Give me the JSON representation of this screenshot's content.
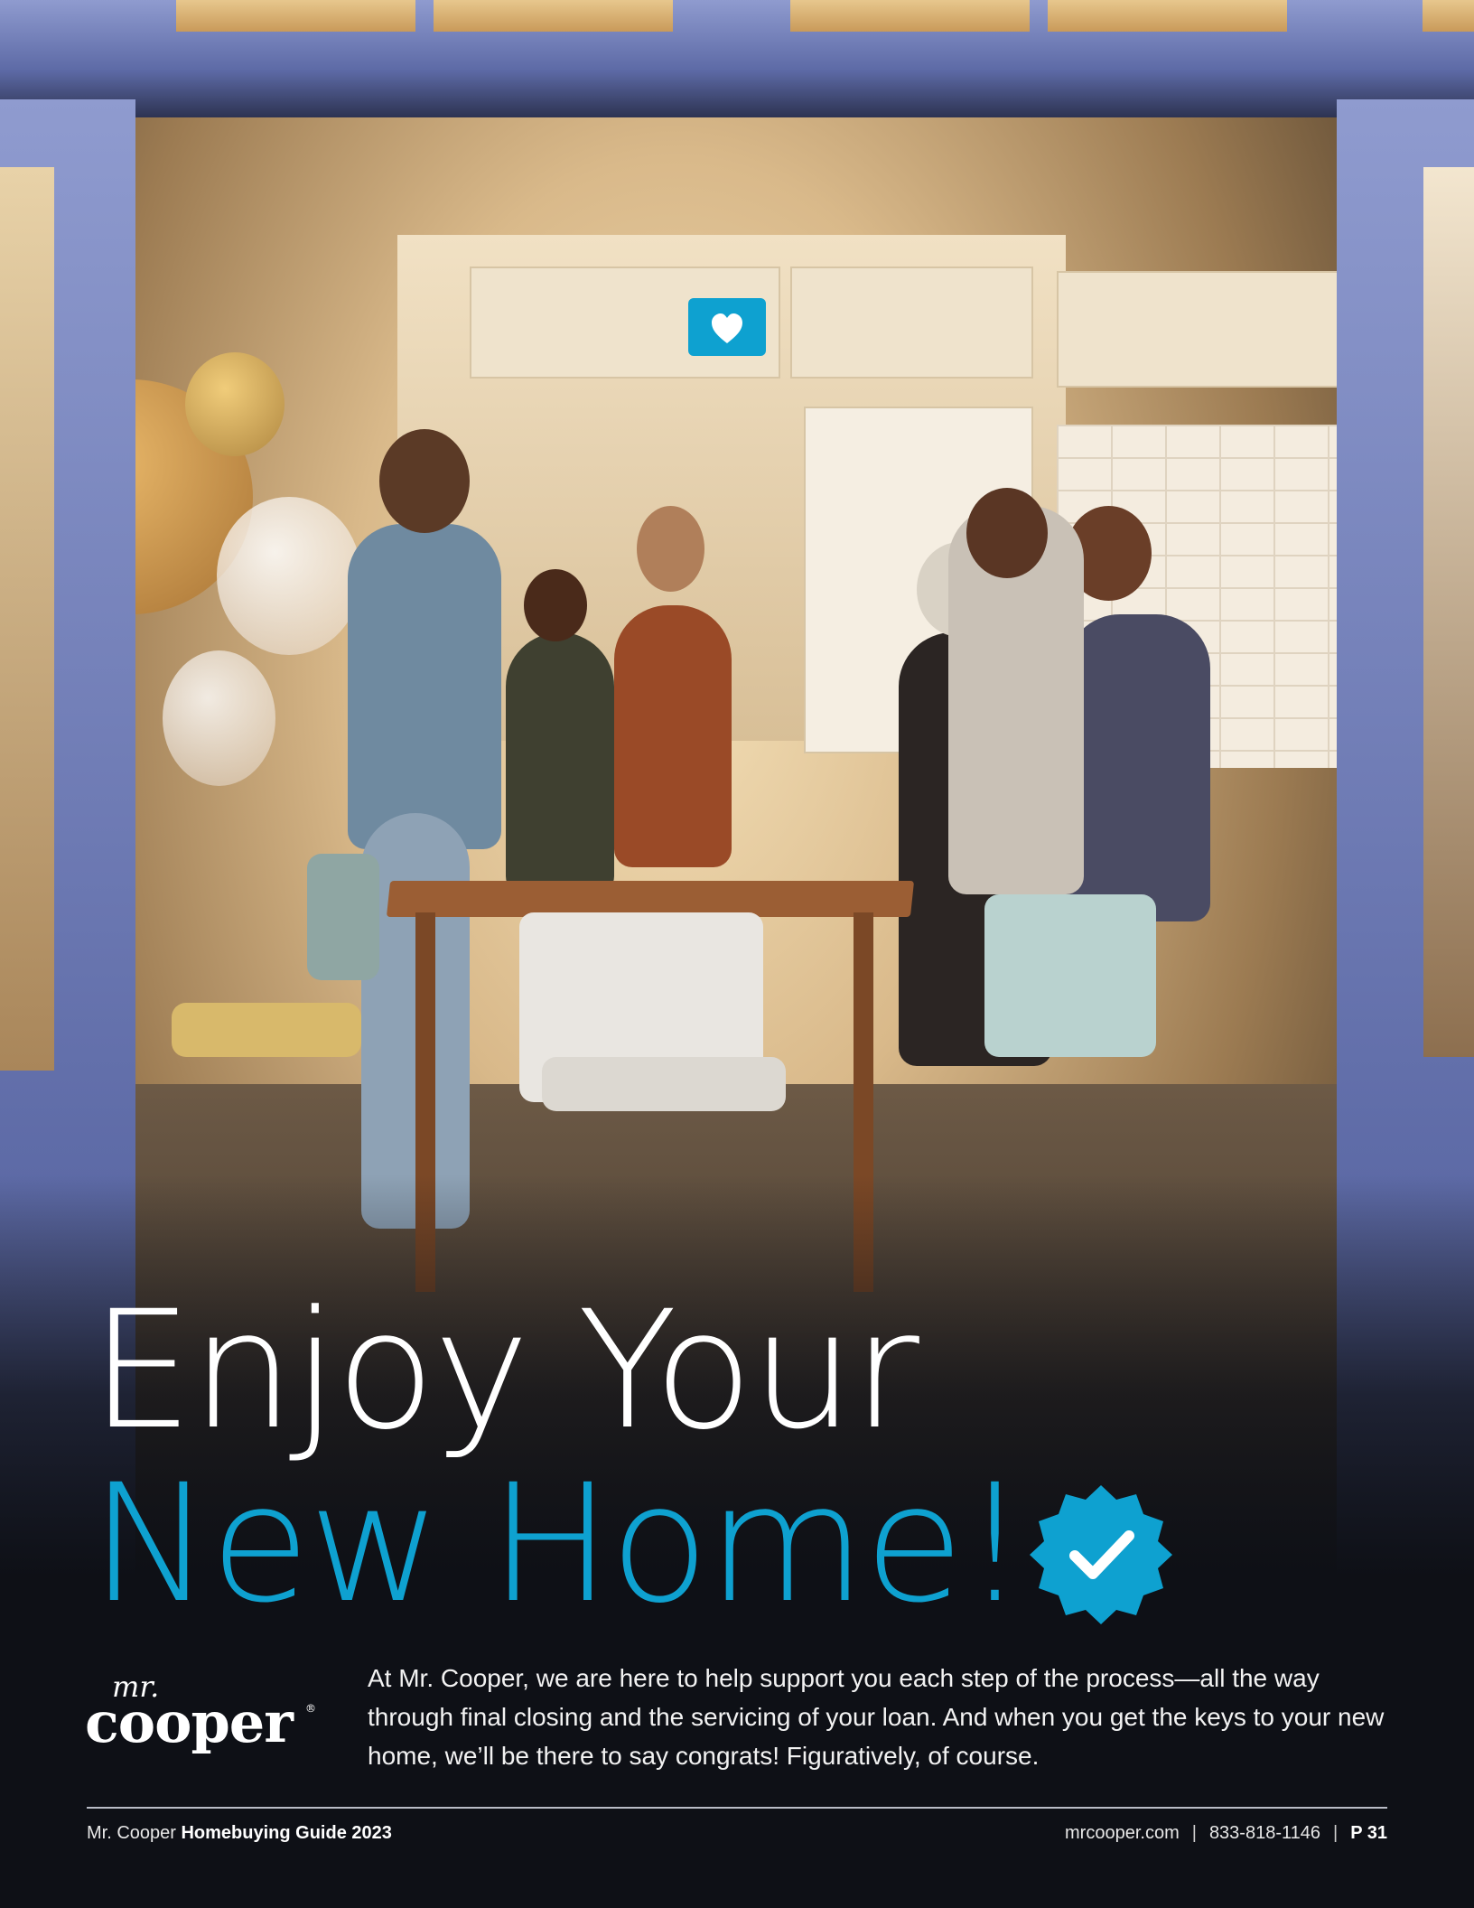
{
  "headline": {
    "line1": "Enjoy Your",
    "line2": "New Home!"
  },
  "brand": {
    "logo_small": "mr.",
    "logo_large": "cooper"
  },
  "body": "At Mr. Cooper, we are here to help support you each step of the process—all the way through final closing and the servicing of your loan. And when you get the keys to your new home, we’ll be there to say congrats! Figuratively, of course.",
  "footer": {
    "brand": "Mr. Cooper",
    "guide_title": "Homebuying Guide 2023",
    "website": "mrcooper.com",
    "phone": "833-818-1146",
    "separator": "|",
    "page": "P 31"
  },
  "icons": {
    "notification": "heart-like-icon",
    "badge": "verified-check-badge-icon"
  },
  "colors": {
    "accent": "#0ea1d0",
    "background": "#0e1016",
    "text": "#ffffff"
  }
}
